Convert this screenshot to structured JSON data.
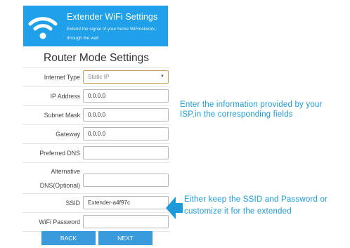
{
  "banner": {
    "title": "Extender WiFi Settings",
    "subtitle": "Extend the signal of your home WiFinetwork, through the wall",
    "icon": "wifi-icon",
    "color": "#1fa0e8"
  },
  "form": {
    "title": "Router Mode Settings",
    "fields": [
      {
        "label": "Internet Type",
        "value": "Static IP"
      },
      {
        "label": "IP Address",
        "value": "0.0.0.0"
      },
      {
        "label": "Subnet Mask",
        "value": "0.0.0.0"
      },
      {
        "label": "Gateway",
        "value": "0.0.0.0"
      },
      {
        "label": "Preferred DNS",
        "value": ""
      },
      {
        "label": "Alternative DNS(Optional)",
        "value": ""
      },
      {
        "label": "SSID",
        "value": "Extender-a4f97c"
      },
      {
        "label": "WiFi Password",
        "value": ""
      }
    ]
  },
  "buttons": {
    "back": "BACK",
    "next": "NEXT"
  },
  "notes": {
    "isp_info": "Enter the information provided by your ISP,in the corresponding fields",
    "ssid_info": "Either keep the SSID and Password or customize it for the extended"
  },
  "accent_color": "#1f9ad8"
}
